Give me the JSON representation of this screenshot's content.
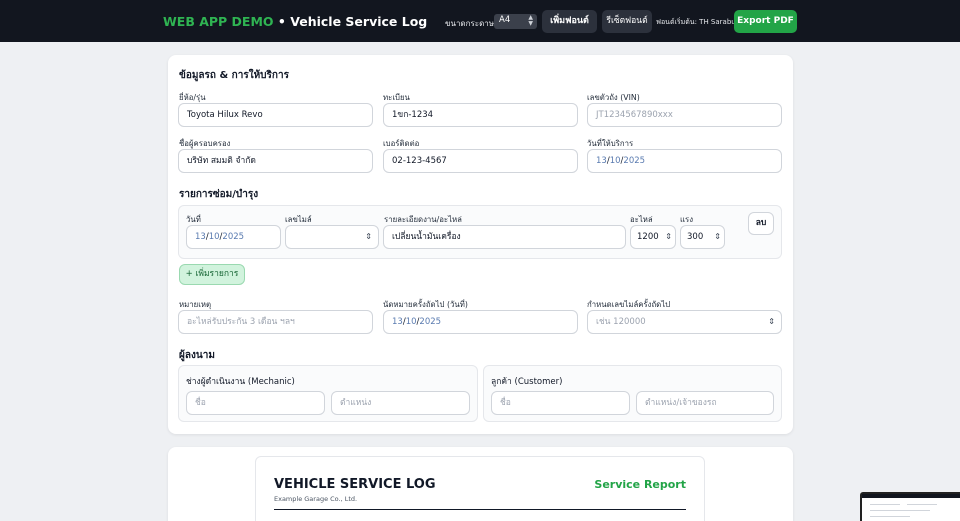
{
  "header": {
    "brand_accent": "WEB APP DEMO",
    "brand_sep": " • ",
    "brand_title": "Vehicle Service Log",
    "paper_label": "ขนาดกระดาษ",
    "paper_value": "A4",
    "add_font": "เพิ่มฟอนต์",
    "reset_font": "รีเซ็ตฟอนต์",
    "font_status": "ฟอนต์เริ่มต้น: TH Sarabun",
    "export": "Export PDF"
  },
  "vehicle": {
    "section_title": "ข้อมูลรถ & การให้บริการ",
    "brand_model_label": "ยี่ห้อ/รุ่น",
    "brand_model_value": "Toyota Hilux Revo",
    "plate_label": "ทะเบียน",
    "plate_value": "1ขก-1234",
    "vin_label": "เลขตัวถัง (VIN)",
    "vin_placeholder": "JT1234567890xxx",
    "owner_label": "ชื่อผู้ครอบครอง",
    "owner_value": "บริษัท สมมติ จำกัด",
    "phone_label": "เบอร์ติดต่อ",
    "phone_value": "02-123-4567",
    "service_date_label": "วันที่ให้บริการ",
    "service_date": {
      "d": "13",
      "m": "10",
      "y": "2025"
    }
  },
  "repairs": {
    "section_title": "รายการซ่อม/บำรุง",
    "date_label": "วันที่",
    "date": {
      "d": "13",
      "m": "10",
      "y": "2025"
    },
    "mileage_label": "เลขไมล์",
    "detail_label": "รายละเอียดงาน/อะไหล่",
    "detail_value": "เปลี่ยนน้ำมันเครื่อง",
    "parts_label": "อะไหล่",
    "parts_value": "1200",
    "labor_label": "แรง",
    "labor_value": "300",
    "delete": "ลบ",
    "add": "+ เพิ่มรายการ"
  },
  "notes": {
    "note_label": "หมายเหตุ",
    "note_placeholder": "อะไหล่รับประกัน 3 เดือน ฯลฯ",
    "next_date_label": "นัดหมายครั้งถัดไป (วันที่)",
    "next_date": {
      "d": "13",
      "m": "10",
      "y": "2025"
    },
    "next_mileage_label": "กำหนดเลขไมล์ครั้งถัดไป",
    "next_mileage_placeholder": "เช่น 120000"
  },
  "signers": {
    "section_title": "ผู้ลงนาม",
    "mechanic_title": "ช่างผู้ดำเนินงาน (Mechanic)",
    "mechanic_name_placeholder": "ชื่อ",
    "mechanic_role_placeholder": "ตำแหน่ง",
    "customer_title": "ลูกค้า (Customer)",
    "customer_name_placeholder": "ชื่อ",
    "customer_role_placeholder": "ตำแหน่ง/เจ้าของรถ"
  },
  "preview": {
    "title": "VEHICLE SERVICE LOG",
    "company": "Example Garage Co., Ltd.",
    "report": "Service Report"
  },
  "colors": {
    "accent_green": "#22a447",
    "header_bg": "#12161f",
    "date_text": "#5a7bb0"
  }
}
